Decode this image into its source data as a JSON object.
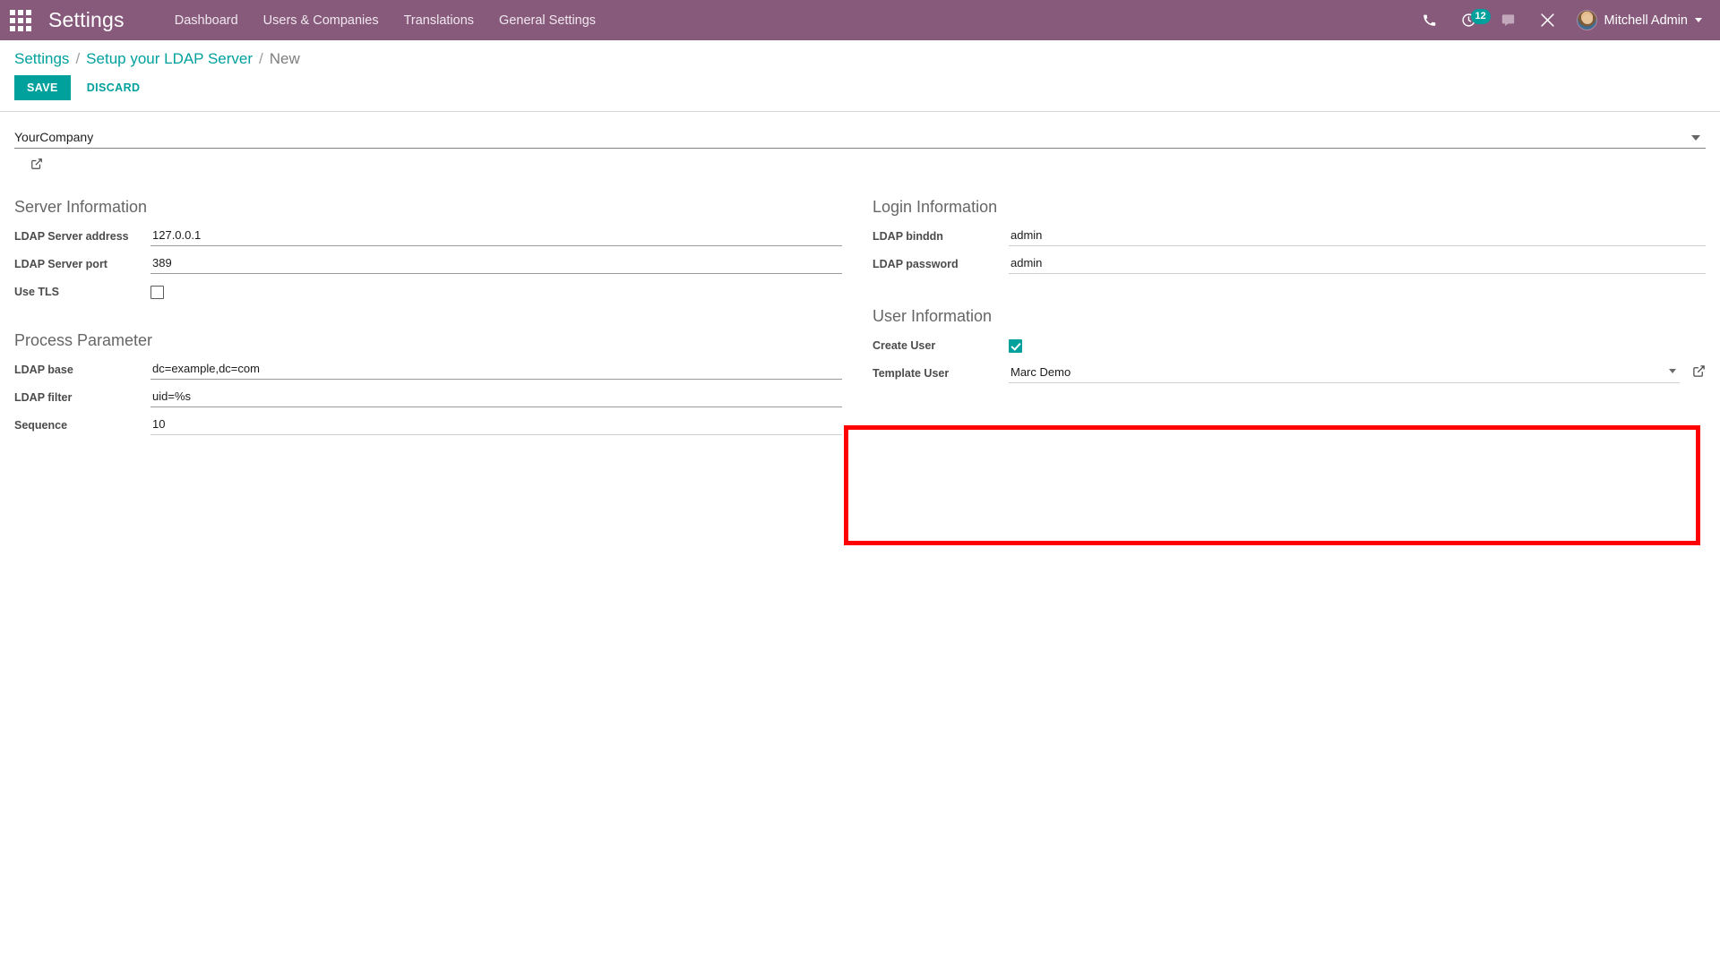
{
  "navbar": {
    "apps_icon": "apps-grid-icon",
    "brand": "Settings",
    "menu": [
      {
        "label": "Dashboard"
      },
      {
        "label": "Users & Companies"
      },
      {
        "label": "Translations"
      },
      {
        "label": "General Settings"
      }
    ],
    "sys_icons": [
      {
        "name": "phone-icon"
      },
      {
        "name": "activity-clock-icon",
        "badge": "12"
      },
      {
        "name": "messages-icon"
      },
      {
        "name": "debug-tools-icon"
      }
    ],
    "user": {
      "name": "Mitchell Admin",
      "avatar": "user-avatar"
    }
  },
  "control_panel": {
    "breadcrumb": {
      "root": "Settings",
      "sep1": "/",
      "parent": "Setup your LDAP Server",
      "sep2": "/",
      "current": "New"
    },
    "buttons": {
      "save": "SAVE",
      "discard": "DISCARD"
    }
  },
  "form": {
    "company": {
      "value": "YourCompany",
      "placeholder": ""
    },
    "groups": {
      "server_information": {
        "title": "Server Information",
        "fields": [
          {
            "label": "LDAP Server address",
            "value": "127.0.0.1",
            "type": "text"
          },
          {
            "label": "LDAP Server port",
            "value": "389",
            "type": "text"
          },
          {
            "label": "Use TLS",
            "value": "",
            "type": "checkbox",
            "checked": false
          }
        ]
      },
      "process_parameter": {
        "title": "Process Parameter",
        "fields": [
          {
            "label": "LDAP base",
            "value": "dc=example,dc=com",
            "type": "text"
          },
          {
            "label": "LDAP filter",
            "value": "uid=%s",
            "type": "text"
          },
          {
            "label": "Sequence",
            "value": "10",
            "type": "text"
          }
        ]
      },
      "login_information": {
        "title": "Login Information",
        "fields": [
          {
            "label": "LDAP binddn",
            "value": "admin",
            "type": "text"
          },
          {
            "label": "LDAP password",
            "value": "admin",
            "type": "text"
          }
        ]
      },
      "user_information": {
        "title": "User Information",
        "fields": [
          {
            "label": "Create User",
            "value": "",
            "type": "checkbox",
            "checked": true
          },
          {
            "label": "Template User",
            "value": "Marc Demo",
            "type": "many2one"
          }
        ]
      }
    }
  },
  "annotation": {
    "highlight_color": "#FF0000",
    "target": "User Information"
  },
  "colors": {
    "navbar": "#875A7B",
    "accent": "#00A09D",
    "highlight": "#FF0000",
    "text": "#4b4b4b"
  }
}
